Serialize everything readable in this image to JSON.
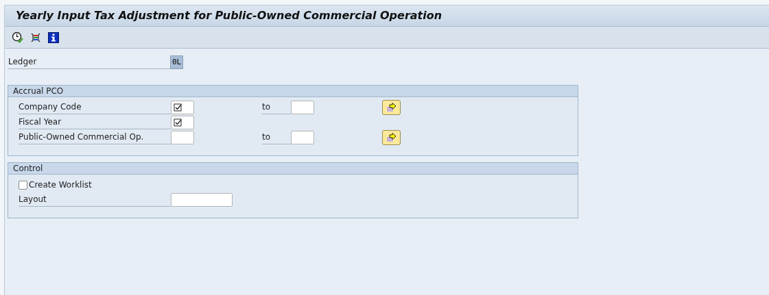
{
  "window": {
    "title": "Yearly Input Tax Adjustment for Public-Owned Commercial Operation"
  },
  "ledger": {
    "label": "Ledger",
    "value": "0L"
  },
  "groups": [
    {
      "title": "Accrual PCO",
      "rows": [
        {
          "kind": "range",
          "label": "Company Code",
          "required": true,
          "to_label": "to"
        },
        {
          "kind": "single",
          "label": "Fiscal Year",
          "required": true
        },
        {
          "kind": "range",
          "label": "Public-Owned Commercial Op.",
          "required": false,
          "to_label": "to"
        }
      ]
    },
    {
      "title": "Control",
      "rows": [
        {
          "kind": "checkbox",
          "label": "Create Worklist",
          "checked": false
        },
        {
          "kind": "wide",
          "label": "Layout"
        }
      ]
    }
  ]
}
